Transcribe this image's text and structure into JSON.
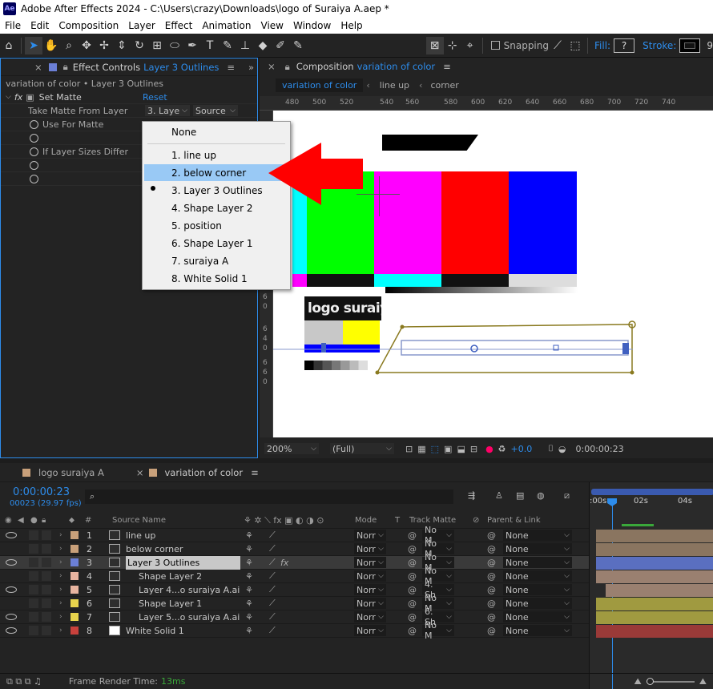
{
  "window": {
    "title": "Adobe After Effects 2024 - C:\\Users\\crazy\\Downloads\\logo of Suraiya A.aep *",
    "icon": "Ae"
  },
  "menu": [
    "File",
    "Edit",
    "Composition",
    "Layer",
    "Effect",
    "Animation",
    "View",
    "Window",
    "Help"
  ],
  "toolbar": {
    "snapping": "Snapping",
    "fill": "Fill:",
    "stroke": "Stroke:",
    "fill_value": "?",
    "stroke_value": "9"
  },
  "effect_controls": {
    "header_label": "Effect Controls",
    "header_layer": "Layer 3 Outlines",
    "breadcrumb": "variation of color • Layer 3 Outlines",
    "effect_name": "Set Matte",
    "reset": "Reset",
    "take_matte_label": "Take Matte From Layer",
    "take_matte_value": "3. Laye",
    "source_value": "Source",
    "use_for_matte": "Use For Matte",
    "if_sizes_differ": "If Layer Sizes Differ"
  },
  "dropdown": {
    "items": [
      "None",
      "1. line up",
      "2. below corner",
      "3. Layer 3 Outlines",
      "4. Shape Layer 2",
      "5. position",
      "6. Shape Layer 1",
      "7. suraiya A",
      "8. White Solid 1"
    ],
    "highlighted": "2. below corner",
    "checked": "3. Layer 3 Outlines"
  },
  "composition": {
    "header_label": "Composition",
    "header_comp": "variation of color",
    "tabs": [
      "variation of color",
      "line up",
      "corner"
    ],
    "ruler_ticks": [
      "480",
      "500",
      "520",
      "540",
      "560",
      "580",
      "600",
      "620",
      "640",
      "660",
      "680",
      "700",
      "720",
      "740"
    ],
    "left_ruler_digits": [
      "6",
      "0",
      "6",
      "4",
      "0",
      "6",
      "6",
      "0"
    ],
    "logo_text": "logo suraiy",
    "zoom": "200%",
    "quality": "(Full)",
    "exposure": "+0.0",
    "timecode": "0:00:00:23"
  },
  "timeline": {
    "tabs": [
      "logo suraiya A",
      "variation of color"
    ],
    "timecode": "0:00:00:23",
    "frames": "00023 (29.97 fps)",
    "search_placeholder": "",
    "columns": {
      "num": "#",
      "source_name": "Source Name",
      "mode": "Mode",
      "t": "T",
      "track_matte": "Track Matte",
      "parent": "Parent & Link"
    },
    "time_ticks": [
      ":00s",
      "02s",
      "04s"
    ],
    "layers": [
      {
        "num": "1",
        "name": "line up",
        "color": "#c8a07a",
        "mode": "Norr",
        "matte": "No M",
        "parent": "None"
      },
      {
        "num": "2",
        "name": "below corner",
        "color": "#c8a07a",
        "mode": "Norr",
        "matte": "No M",
        "parent": "None"
      },
      {
        "num": "3",
        "name": "Layer 3 Outlines",
        "color": "#6b7fd6",
        "mode": "Norr",
        "matte": "No M",
        "parent": "None"
      },
      {
        "num": "4",
        "name": "Shape Layer 2",
        "color": "#e8b4a0",
        "mode": "Norr",
        "matte": "No M",
        "parent": "None"
      },
      {
        "num": "5",
        "name": "Layer 4...o suraiya A.ai",
        "color": "#e8b4a0",
        "mode": "Norr",
        "matte": "4. Sh",
        "parent": "None"
      },
      {
        "num": "6",
        "name": "Shape Layer 1",
        "color": "#e8d44d",
        "mode": "Norr",
        "matte": "No M",
        "parent": "None"
      },
      {
        "num": "7",
        "name": "Layer 5...o suraiya A.ai",
        "color": "#e8d44d",
        "mode": "Norr",
        "matte": "6. Sh",
        "parent": "None"
      },
      {
        "num": "8",
        "name": "White Solid 1",
        "color": "#c8413c",
        "mode": "Norr",
        "matte": "No M",
        "parent": "None"
      }
    ],
    "render_label": "Frame Render Time:",
    "render_value": "13ms"
  }
}
